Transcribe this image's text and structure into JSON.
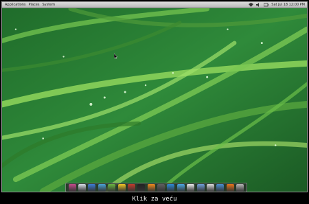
{
  "topbar": {
    "menus": [
      "Applications",
      "Places",
      "System"
    ],
    "clock": "Sat Jul 18 12:00 PM",
    "tray_icons": [
      "network-icon",
      "volume-icon",
      "battery-icon"
    ]
  },
  "dock": {
    "icons": [
      {
        "name": "home-folder-icon",
        "color": "#c44a8b"
      },
      {
        "name": "finder-icon",
        "color": "#d7dde6"
      },
      {
        "name": "web-browser-icon",
        "color": "#3c7cd6"
      },
      {
        "name": "chat-icon",
        "color": "#4aa2d6"
      },
      {
        "name": "battery-app-icon",
        "color": "#69b540"
      },
      {
        "name": "radiation-app-icon",
        "color": "#f2c524"
      },
      {
        "name": "settings-icon",
        "color": "#c23c2c"
      },
      {
        "name": "terminal-icon",
        "color": "#222222"
      },
      {
        "name": "media-player-icon",
        "color": "#f08a1c"
      },
      {
        "name": "text-editor-icon",
        "color": "#5f5f5f"
      },
      {
        "name": "globe-icon",
        "color": "#2b8ad6"
      },
      {
        "name": "photo-icon",
        "color": "#4ba7e3"
      },
      {
        "name": "monitor-icon",
        "color": "#e9e9e9"
      },
      {
        "name": "documents-icon",
        "color": "#6f9fd8"
      },
      {
        "name": "printer-icon",
        "color": "#d8d8d8"
      },
      {
        "name": "sync-icon",
        "color": "#4a8fd1"
      },
      {
        "name": "disc-icon",
        "color": "#e9741b"
      },
      {
        "name": "trash-icon",
        "color": "#b5b5b5"
      }
    ]
  },
  "caption": "Klik za veću"
}
